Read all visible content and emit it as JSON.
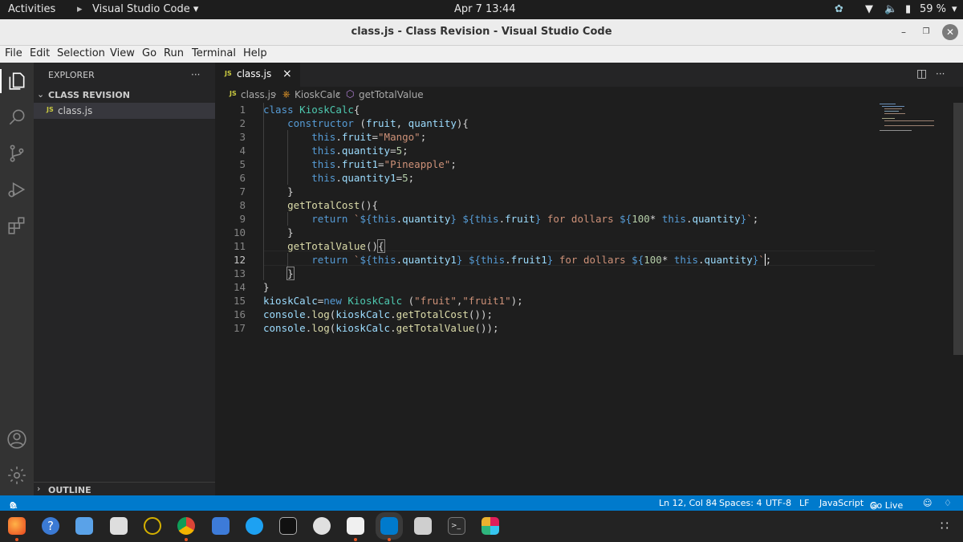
{
  "topbar": {
    "activities": "Activities",
    "app_name": "Visual Studio Code",
    "clock": "Apr 7  13:44",
    "battery": "59 %"
  },
  "window": {
    "title": "class.js - Class Revision - Visual Studio Code"
  },
  "menu": [
    "File",
    "Edit",
    "Selection",
    "View",
    "Go",
    "Run",
    "Terminal",
    "Help"
  ],
  "activity_bar": {
    "icons": [
      "explorer-icon",
      "search-icon",
      "source-control-icon",
      "run-debug-icon",
      "extensions-icon",
      "account-icon",
      "manage-gear-icon"
    ]
  },
  "sidebar": {
    "header": "EXPLORER",
    "more": "···",
    "folder": "CLASS REVISION",
    "file": "class.js",
    "file_badge": "JS",
    "outline": "OUTLINE"
  },
  "editor": {
    "tab": {
      "badge": "JS",
      "label": "class.js",
      "close": "×"
    },
    "breadcrumb": {
      "file": "class.js",
      "class": "KioskCalc",
      "method": "getTotalValue"
    },
    "current_line": 12
  },
  "code_lines": [
    "class KioskCalc{",
    "    constructor (fruit, quantity){",
    "        this.fruit=\"Mango\";",
    "        this.quantity=5;",
    "        this.fruit1=\"Pineapple\";",
    "        this.quantity1=5;",
    "    }",
    "    getTotalCost(){",
    "        return `${this.quantity} ${this.fruit} for dollars ${100* this.quantity}`;",
    "    }",
    "    getTotalValue(){",
    "        return `${this.quantity1} ${this.fruit1} for dollars ${100* this.quantity}`;",
    "    }",
    "}",
    "kioskCalc=new KioskCalc (\"fruit\",\"fruit1\");",
    "console.log(kioskCalc.getTotalCost());",
    "console.log(kioskCalc.getTotalValue());"
  ],
  "statusbar": {
    "errors": "0",
    "warnings": "0",
    "position": "Ln 12, Col 84",
    "spaces": "Spaces: 4",
    "encoding": "UTF-8",
    "eol": "LF",
    "language": "JavaScript",
    "golive": "Go Live"
  },
  "colors": {
    "statusbar": "#007acc",
    "editor_bg": "#1e1e1e",
    "sidebar_bg": "#252526",
    "activity_bg": "#333333",
    "keyword": "#569cd6",
    "string": "#ce9178",
    "variable": "#9cdcfe",
    "function": "#dcdcaa"
  }
}
